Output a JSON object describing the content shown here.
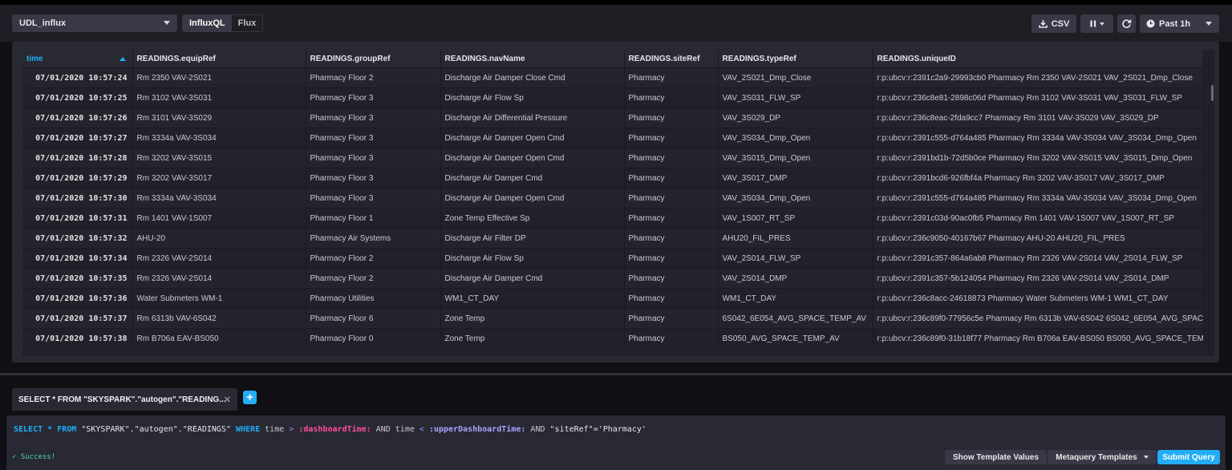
{
  "toolbar": {
    "database": "UDL_influx",
    "languages": [
      "InfluxQL",
      "Flux"
    ],
    "csv_label": "CSV",
    "time_range": "Past 1h",
    "icons": [
      "download-icon",
      "pause-icon",
      "refresh-icon",
      "clock-icon"
    ]
  },
  "table": {
    "columns": [
      "time",
      "READINGS.equipRef",
      "READINGS.groupRef",
      "READINGS.navName",
      "READINGS.siteRef",
      "READINGS.typeRef",
      "READINGS.uniqueID"
    ],
    "rows": [
      [
        "07/01/2020 10:57:24",
        "Rm 2350 VAV-2S021",
        "Pharmacy Floor 2",
        "Discharge Air Damper Close Cmd",
        "Pharmacy",
        "VAV_2S021_Dmp_Close",
        "r:p:ubcv:r:2391c2a9-29993cb0 Pharmacy Rm 2350 VAV-2S021 VAV_2S021_Dmp_Close"
      ],
      [
        "07/01/2020 10:57:25",
        "Rm 3102 VAV-3S031",
        "Pharmacy Floor 3",
        "Discharge Air Flow Sp",
        "Pharmacy",
        "VAV_3S031_FLW_SP",
        "r:p:ubcv:r:236c8e81-2898c06d Pharmacy Rm 3102 VAV-3S031 VAV_3S031_FLW_SP"
      ],
      [
        "07/01/2020 10:57:26",
        "Rm 3101 VAV-3S029",
        "Pharmacy Floor 3",
        "Discharge Air Differential Pressure",
        "Pharmacy",
        "VAV_3S029_DP",
        "r:p:ubcv:r:236c8eac-2fda9cc7 Pharmacy Rm 3101 VAV-3S029 VAV_3S029_DP"
      ],
      [
        "07/01/2020 10:57:27",
        "Rm 3334a VAV-3S034",
        "Pharmacy Floor 3",
        "Discharge Air Damper Open Cmd",
        "Pharmacy",
        "VAV_3S034_Dmp_Open",
        "r:p:ubcv:r:2391c555-d764a485 Pharmacy Rm 3334a VAV-3S034 VAV_3S034_Dmp_Open"
      ],
      [
        "07/01/2020 10:57:28",
        "Rm 3202 VAV-3S015",
        "Pharmacy Floor 3",
        "Discharge Air Damper Open Cmd",
        "Pharmacy",
        "VAV_3S015_Dmp_Open",
        "r:p:ubcv:r:2391bd1b-72d5b0ce Pharmacy Rm 3202 VAV-3S015 VAV_3S015_Dmp_Open"
      ],
      [
        "07/01/2020 10:57:29",
        "Rm 3202 VAV-3S017",
        "Pharmacy Floor 3",
        "Discharge Air Damper Cmd",
        "Pharmacy",
        "VAV_3S017_DMP",
        "r:p:ubcv:r:2391bcd6-926fbf4a Pharmacy Rm 3202 VAV-3S017 VAV_3S017_DMP"
      ],
      [
        "07/01/2020 10:57:30",
        "Rm 3334a VAV-3S034",
        "Pharmacy Floor 3",
        "Discharge Air Damper Open Cmd",
        "Pharmacy",
        "VAV_3S034_Dmp_Open",
        "r:p:ubcv:r:2391c555-d764a485 Pharmacy Rm 3334a VAV-3S034 VAV_3S034_Dmp_Open"
      ],
      [
        "07/01/2020 10:57:31",
        "Rm 1401 VAV-1S007",
        "Pharmacy Floor 1",
        "Zone Temp Effective Sp",
        "Pharmacy",
        "VAV_1S007_RT_SP",
        "r:p:ubcv:r:2391c03d-90ac0fb5 Pharmacy Rm 1401 VAV-1S007 VAV_1S007_RT_SP"
      ],
      [
        "07/01/2020 10:57:32",
        "AHU-20",
        "Pharmacy Air Systems",
        "Discharge Air Filter DP",
        "Pharmacy",
        "AHU20_FIL_PRES",
        "r:p:ubcv:r:236c9050-40167b67 Pharmacy AHU-20 AHU20_FIL_PRES"
      ],
      [
        "07/01/2020 10:57:34",
        "Rm 2326 VAV-2S014",
        "Pharmacy Floor 2",
        "Discharge Air Flow Sp",
        "Pharmacy",
        "VAV_2S014_FLW_SP",
        "r:p:ubcv:r:2391c357-864a6ab8 Pharmacy Rm 2326 VAV-2S014 VAV_2S014_FLW_SP"
      ],
      [
        "07/01/2020 10:57:35",
        "Rm 2326 VAV-2S014",
        "Pharmacy Floor 2",
        "Discharge Air Damper Cmd",
        "Pharmacy",
        "VAV_2S014_DMP",
        "r:p:ubcv:r:2391c357-5b124054 Pharmacy Rm 2326 VAV-2S014 VAV_2S014_DMP"
      ],
      [
        "07/01/2020 10:57:36",
        "Water Submeters WM-1",
        "Pharmacy Utilities",
        "WM1_CT_DAY",
        "Pharmacy",
        "WM1_CT_DAY",
        "r:p:ubcv:r:236c8acc-24618873 Pharmacy Water Submeters WM-1 WM1_CT_DAY"
      ],
      [
        "07/01/2020 10:57:37",
        "Rm 6313b VAV-6S042",
        "Pharmacy Floor 6",
        "Zone Temp",
        "Pharmacy",
        "6S042_6E054_AVG_SPACE_TEMP_AV",
        "r:p:ubcv:r:236c89f0-77956c5e Pharmacy Rm 6313b VAV-6S042 6S042_6E054_AVG_SPACE_TEMP_AV"
      ],
      [
        "07/01/2020 10:57:38",
        "Rm B706a EAV-BS050",
        "Pharmacy Floor 0",
        "Zone Temp",
        "Pharmacy",
        "BS050_AVG_SPACE_TEMP_AV",
        "r:p:ubcv:r:236c89f0-31b18f77 Pharmacy Rm B706a EAV-BS050 BS050_AVG_SPACE_TEMP_AV"
      ]
    ]
  },
  "query_editor": {
    "tab_label": "SELECT * FROM \"SKYSPARK\".\"autogen\".\"READING...",
    "query": {
      "select": "SELECT",
      "star": "*",
      "from": "FROM",
      "measurement": "\"SKYSPARK\".\"autogen\".\"READINGS\"",
      "where": "WHERE",
      "time1": "time",
      "gt": ">",
      "var1": ":dashboardTime:",
      "and1": "AND",
      "time2": "time",
      "lt": "<",
      "var2": ":upperDashboardTime:",
      "and2": "AND",
      "cond": "\"siteRef\"='Pharmacy'"
    },
    "status": "✓ Success!",
    "show_template_values": "Show Template Values",
    "metaquery_templates": "Metaquery Templates",
    "submit_query": "Submit Query"
  },
  "colors": {
    "accent": "#22adf6",
    "success": "#4ed8a0",
    "template_var_pink": "#ff4d9e",
    "template_var_purple": "#a5a6ff"
  }
}
